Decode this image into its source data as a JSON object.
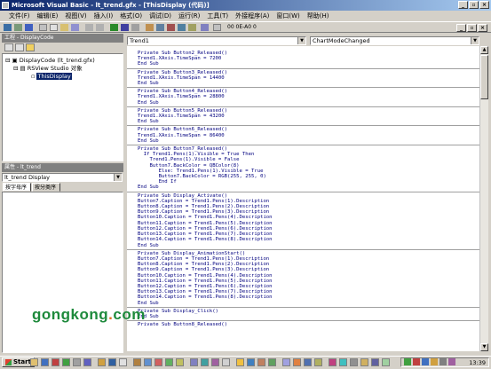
{
  "window": {
    "title": "Microsoft Visual Basic - lt_trend.gfx - [ThisDisplay (代码)]"
  },
  "window_controls": {
    "minimize": "_",
    "restore": "▫",
    "close": "×"
  },
  "menu": [
    "文件(F)",
    "编辑(E)",
    "视图(V)",
    "插入(I)",
    "格式(O)",
    "调试(D)",
    "运行(R)",
    "工具(T)",
    "外接程序(A)",
    "窗口(W)",
    "帮助(H)"
  ],
  "toolbar": {
    "coord": "00 0E-A0 0"
  },
  "project": {
    "title": "工程 - DisplayCode",
    "tree": [
      "DisplayCode (lt_trend.gfx)",
      "RSView Studio 对象",
      "ThisDisplay"
    ]
  },
  "properties": {
    "title": "属性 - lt_trend",
    "object": "lt_trend Display",
    "tabs": [
      "按字母序",
      "按分类序"
    ]
  },
  "code": {
    "object_combo": "Trend1",
    "proc_combo": "ChartModeChanged",
    "blocks": [
      [
        "Private Sub Button2_Released()",
        "Trend1.XAxis.TimeSpan = 7200",
        "End Sub"
      ],
      [
        "Private Sub Button3_Released()",
        "Trend1.XAxis.TimeSpan = 14400",
        "End Sub"
      ],
      [
        "Private Sub Button4_Released()",
        "Trend1.XAxis.TimeSpan = 28800",
        "End Sub"
      ],
      [
        "Private Sub Button5_Released()",
        "Trend1.XAxis.TimeSpan = 43200",
        "End Sub"
      ],
      [
        "Private Sub Button6_Released()",
        "Trend1.XAxis.TimeSpan = 86400",
        "End Sub"
      ],
      [
        "",
        "Private Sub Button7_Released()",
        "  If Trend1.Pens(1).Visible = True Then",
        "    Trend1.Pens(1).Visible = False",
        "    Button7.BackColor = QBColor(8)",
        "       Else: Trend1.Pens(1).Visible = True",
        "       Button7.BackColor = RGB(255, 255, 0)",
        "       End If",
        "End Sub"
      ],
      [
        "",
        "Private Sub Display_Activate()",
        "Button7.Caption = Trend1.Pens(1).Description",
        "Button8.Caption = Trend1.Pens(2).Description",
        "Button9.Caption = Trend1.Pens(3).Description",
        "Button10.Caption = Trend1.Pens(4).Description",
        "Button11.Caption = Trend1.Pens(5).Description",
        "Button12.Caption = Trend1.Pens(6).Description",
        "Button13.Caption = Trend1.Pens(7).Description",
        "Button14.Caption = Trend1.Pens(8).Description",
        "",
        "",
        "End Sub"
      ],
      [
        "",
        "Private Sub Display_AnimationStart()",
        "Button7.Caption = Trend1.Pens(1).Description",
        "Button8.Caption = Trend1.Pens(2).Description",
        "Button9.Caption = Trend1.Pens(3).Description",
        "Button10.Caption = Trend1.Pens(4).Description",
        "Button11.Caption = Trend1.Pens(5).Description",
        "Button12.Caption = Trend1.Pens(6).Description",
        "Button13.Caption = Trend1.Pens(7).Description",
        "Button14.Caption = Trend1.Pens(8).Description",
        "",
        "End Sub"
      ],
      [
        "",
        "Private Sub Display_Click()",
        "End Sub"
      ],
      [
        "Private Sub Button8_Released()"
      ]
    ]
  },
  "watermark": {
    "a": "gongkong",
    "b": ".",
    "c": "com"
  },
  "taskbar": {
    "start": "Start",
    "clock": "13:39"
  }
}
